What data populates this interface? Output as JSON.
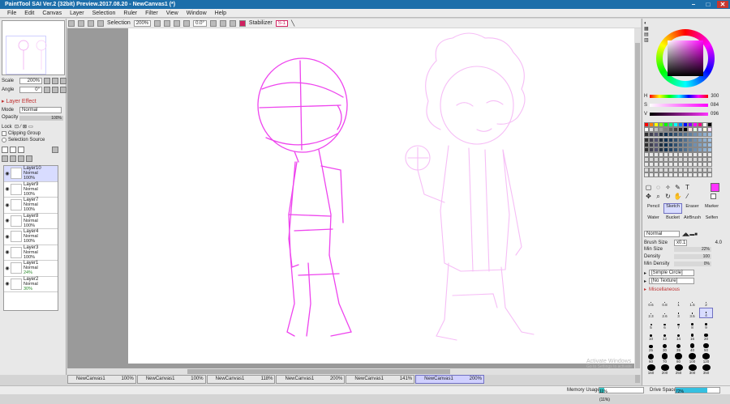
{
  "title": "PaintTool SAI Ver.2 (32bit) Preview.2017.08.20 - NewCanvas1 (*)",
  "menu": [
    "File",
    "Edit",
    "Canvas",
    "Layer",
    "Selection",
    "Ruler",
    "Filter",
    "View",
    "Window",
    "Help"
  ],
  "toolbar": {
    "selection_label": "Selection",
    "zoom": "200%",
    "angle": "0.0°",
    "stabilizer_label": "Stabilizer",
    "stabilizer_value": "S-1"
  },
  "navigator": {
    "scale_label": "Scale",
    "scale_value": "200%",
    "angle_label": "Angle",
    "angle_value": "0°"
  },
  "layer_effect": "Layer Effect",
  "layer_props": {
    "mode_label": "Mode",
    "mode_value": "Normal",
    "opacity_label": "Opacity",
    "opacity_value": "100%",
    "lock_label": "Lock",
    "clipping_label": "Clipping Group",
    "selsrc_label": "Selection Source"
  },
  "layers": [
    {
      "name": "Layer10",
      "mode": "Normal",
      "opacity": "100%"
    },
    {
      "name": "Layer9",
      "mode": "Normal",
      "opacity": "100%"
    },
    {
      "name": "Layer7",
      "mode": "Normal",
      "opacity": "100%"
    },
    {
      "name": "Layer8",
      "mode": "Normal",
      "opacity": "100%"
    },
    {
      "name": "Layer4",
      "mode": "Normal",
      "opacity": "100%"
    },
    {
      "name": "Layer3",
      "mode": "Normal",
      "opacity": "100%"
    },
    {
      "name": "Layer1",
      "mode": "Normal",
      "opacity": "24%"
    },
    {
      "name": "Layer2",
      "mode": "Normal",
      "opacity": "30%"
    }
  ],
  "tabs": [
    {
      "name": "NewCanvas1",
      "zoom": "100%"
    },
    {
      "name": "NewCanvas1",
      "zoom": "100%"
    },
    {
      "name": "NewCanvas1",
      "zoom": "118%"
    },
    {
      "name": "NewCanvas1",
      "zoom": "200%"
    },
    {
      "name": "NewCanvas1",
      "zoom": "141%"
    },
    {
      "name": "NewCanvas1",
      "zoom": "200%"
    }
  ],
  "status": {
    "memory_label": "Memory Usage",
    "memory_value": "11% (11%)",
    "memory_fraction": 0.11,
    "drive_label": "Drive Space",
    "drive_value": "72%",
    "drive_fraction": 0.72
  },
  "watermark": {
    "line1": "Activate Windows",
    "line2": "Go to Settings to activate Windows."
  },
  "color": {
    "h_label": "H",
    "h_value": "300",
    "s_label": "S",
    "s_value": "084",
    "v_label": "V",
    "v_value": "096",
    "current": "#ff33ff"
  },
  "brushes": [
    "Pencil",
    "Sketch",
    "Eraser",
    "Marker",
    "Water",
    "Bucket",
    "AirBrush",
    "Selfen"
  ],
  "brush_props": {
    "mode": "Normal",
    "size_label": "Brush Size",
    "size_mult": "x0.1",
    "size_value": "4.0",
    "minsize_label": "Min Size",
    "minsize_value": "22%",
    "density_label": "Density",
    "density_value": "100",
    "mindensity_label": "Min Density",
    "mindensity_value": "0%",
    "shape": "[Simple Circle]",
    "texture": "[No Texture]",
    "misc_label": "Miscellaneous"
  },
  "brush_sizes": [
    "0.6",
    "0.8",
    "1",
    "1.5",
    "2",
    "2.3",
    "2.6",
    "3",
    "3.5",
    "4",
    "5",
    "6",
    "7",
    "8",
    "9",
    "10",
    "12",
    "14",
    "16",
    "20",
    "25",
    "30",
    "35",
    "40",
    "50",
    "60",
    "70",
    "80",
    "100",
    "120",
    "160",
    "200",
    "250",
    "300",
    "350"
  ],
  "swatch_colors": [
    "#ff0000",
    "#ff8000",
    "#ffff00",
    "#80ff00",
    "#00ff00",
    "#00ff80",
    "#00ffff",
    "#0080ff",
    "#0000ff",
    "#8000ff",
    "#ff00ff",
    "#ff0080",
    "#ffffff",
    "#000000"
  ]
}
